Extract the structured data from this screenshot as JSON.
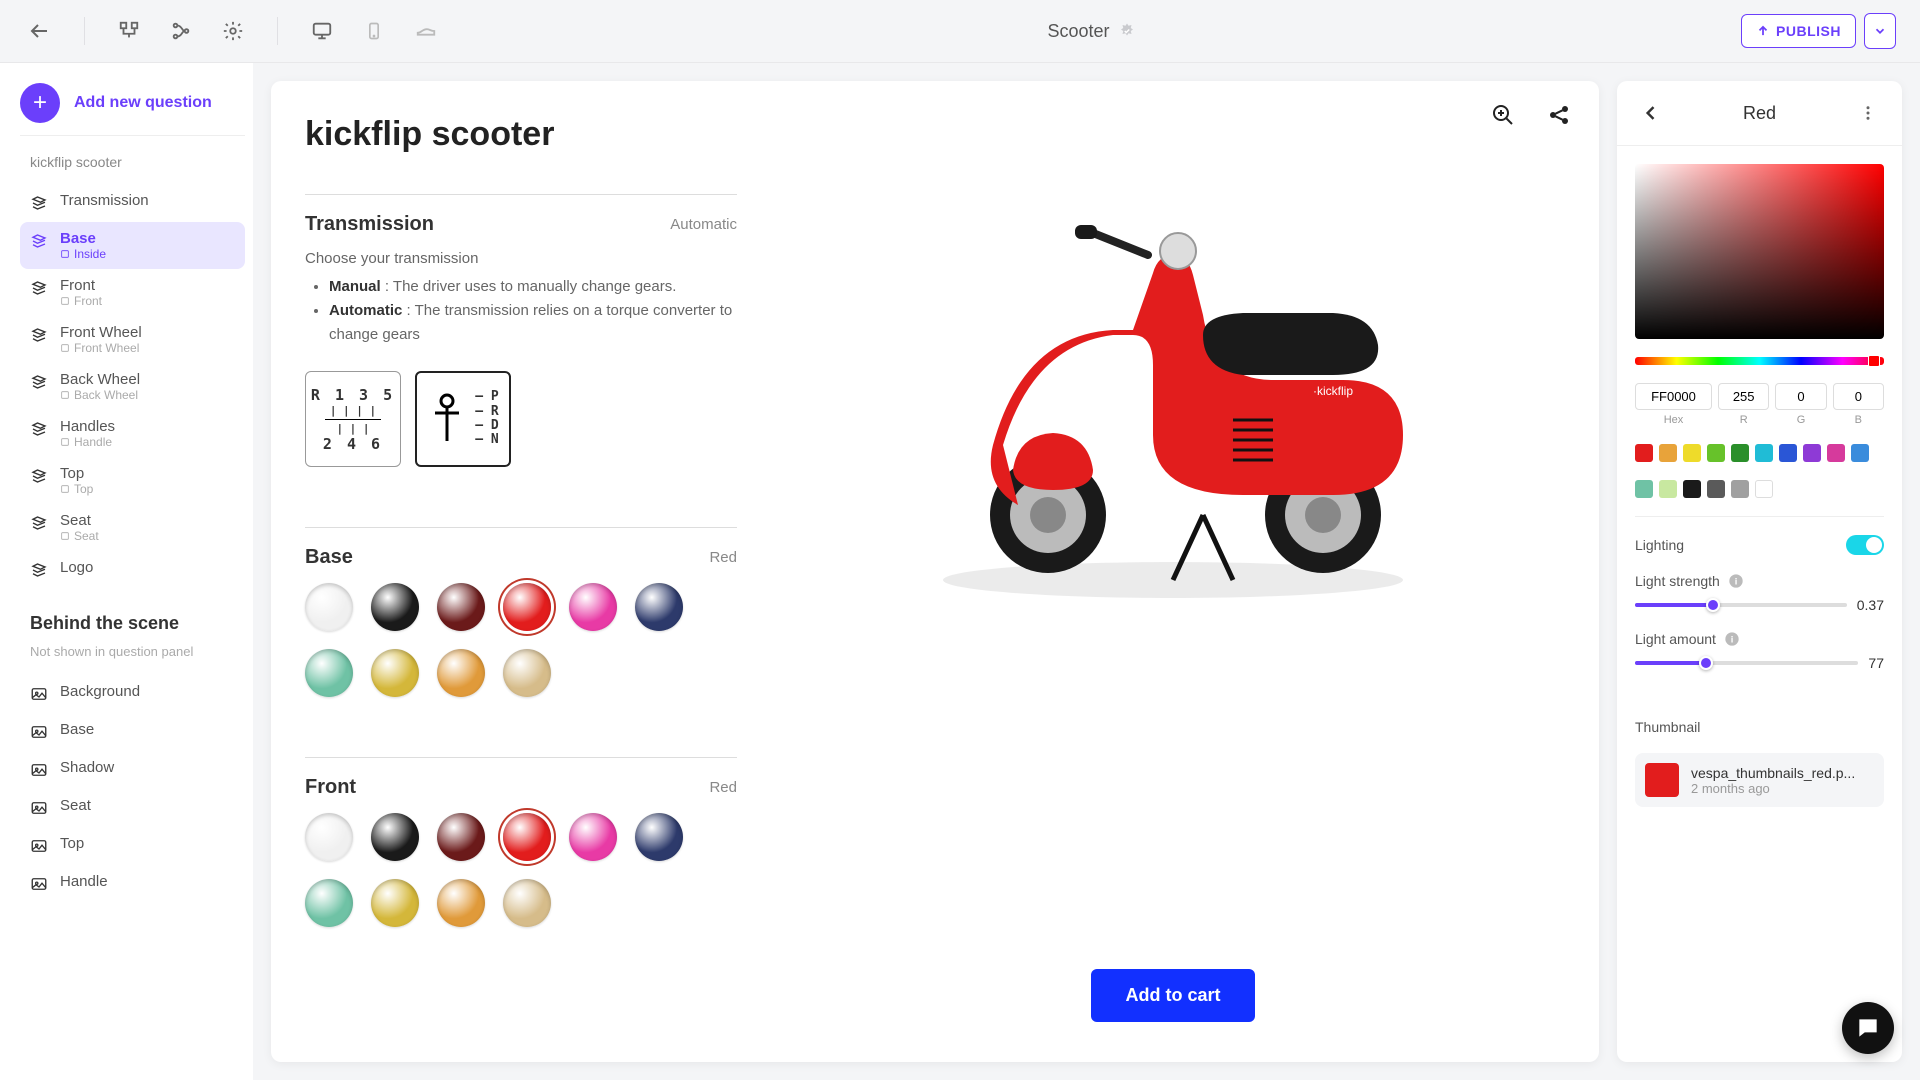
{
  "topbar": {
    "title": "Scooter",
    "publish_label": "PUBLISH"
  },
  "sidebar": {
    "add_label": "Add new question",
    "group_title": "kickflip scooter",
    "items": [
      {
        "label": "Transmission",
        "sub": "",
        "active": false
      },
      {
        "label": "Base",
        "sub": "Inside",
        "active": true
      },
      {
        "label": "Front",
        "sub": "Front",
        "active": false
      },
      {
        "label": "Front Wheel",
        "sub": "Front Wheel",
        "active": false
      },
      {
        "label": "Back Wheel",
        "sub": "Back Wheel",
        "active": false
      },
      {
        "label": "Handles",
        "sub": "Handle",
        "active": false
      },
      {
        "label": "Top",
        "sub": "Top",
        "active": false
      },
      {
        "label": "Seat",
        "sub": "Seat",
        "active": false
      },
      {
        "label": "Logo",
        "sub": "",
        "active": false
      }
    ],
    "behind_title": "Behind the scene",
    "behind_sub": "Not shown in question panel",
    "behind_items": [
      "Background",
      "Base",
      "Shadow",
      "Seat",
      "Top",
      "Handle"
    ]
  },
  "configurator": {
    "title": "kickflip scooter",
    "transmission": {
      "title": "Transmission",
      "value": "Automatic",
      "desc": "Choose your transmission",
      "bullet_manual_label": "Manual",
      "bullet_manual_text": " : The driver uses to manually change gears.",
      "bullet_auto_label": "Automatic",
      "bullet_auto_text": " : The transmission relies on a torque converter to change gears",
      "gear_r1": "R 1 3 5",
      "gear_r2": "2 4 6",
      "auto_letters": "P R D N"
    },
    "base": {
      "title": "Base",
      "value": "Red",
      "colors": [
        "#f0f0f0",
        "#1a1a1a",
        "#6b1a1a",
        "#e21d1d",
        "#e83aa5",
        "#2d3a6b",
        "#6fc2a5",
        "#d4b73a",
        "#e09a3a",
        "#d6bc8a"
      ],
      "selected_index": 3
    },
    "front": {
      "title": "Front",
      "value": "Red",
      "colors": [
        "#f0f0f0",
        "#1a1a1a",
        "#6b1a1a",
        "#e21d1d",
        "#e83aa5",
        "#2d3a6b",
        "#6fc2a5",
        "#d4b73a",
        "#e09a3a",
        "#d6bc8a"
      ],
      "selected_index": 3
    },
    "add_to_cart": "Add to cart"
  },
  "right_panel": {
    "title": "Red",
    "hex": "FF0000",
    "r": "255",
    "g": "0",
    "b": "0",
    "labels": {
      "hex": "Hex",
      "r": "R",
      "g": "G",
      "b": "B"
    },
    "presets_row1": [
      "#e21d1d",
      "#e8a33a",
      "#eedb2a",
      "#67c22a",
      "#2a8f2a",
      "#20bcd6",
      "#2a56d6",
      "#8e3ad6",
      "#d63a9c",
      "#3a8cdc"
    ],
    "presets_row2": [
      "#6fc2a5",
      "#c8e8a0",
      "#1a1a1a",
      "#5a5a5a",
      "#a0a0a0",
      "#ffffff"
    ],
    "lighting_label": "Lighting",
    "light_strength_label": "Light strength",
    "light_strength_value": "0.37",
    "light_strength_ratio": 0.37,
    "light_amount_label": "Light amount",
    "light_amount_value": "77",
    "light_amount_ratio": 0.32,
    "thumbnail_label": "Thumbnail",
    "thumbnail_file": "vespa_thumbnails_red.p...",
    "thumbnail_age": "2 months ago"
  }
}
